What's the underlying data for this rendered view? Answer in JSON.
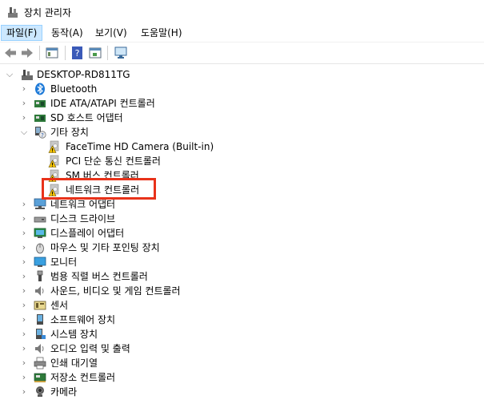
{
  "window": {
    "title": "장치 관리자"
  },
  "menu": {
    "file": "파일(F)",
    "action": "동작(A)",
    "view": "보기(V)",
    "help": "도움말(H)"
  },
  "tree": {
    "root": "DESKTOP-RD811TG",
    "items": [
      {
        "label": "Bluetooth",
        "icon": "bluetooth-icon"
      },
      {
        "label": "IDE ATA/ATAPI 컨트롤러",
        "icon": "ide-controller-icon"
      },
      {
        "label": "SD 호스트 어댑터",
        "icon": "sd-host-icon"
      },
      {
        "label": "기타 장치",
        "icon": "other-devices-icon",
        "expanded": true,
        "children": [
          {
            "label": "FaceTime HD Camera (Built-in)",
            "icon": "warning-device-icon"
          },
          {
            "label": "PCI 단순 통신 컨트롤러",
            "icon": "warning-device-icon"
          },
          {
            "label": "SM 버스 컨트롤러",
            "icon": "warning-device-icon"
          },
          {
            "label": "네트워크 컨트롤러",
            "icon": "warning-device-icon"
          }
        ]
      },
      {
        "label": "네트워크 어댑터",
        "icon": "network-adapter-icon"
      },
      {
        "label": "디스크 드라이브",
        "icon": "disk-drive-icon"
      },
      {
        "label": "디스플레이 어댑터",
        "icon": "display-adapter-icon"
      },
      {
        "label": "마우스 및 기타 포인팅 장치",
        "icon": "mouse-icon"
      },
      {
        "label": "모니터",
        "icon": "monitor-icon"
      },
      {
        "label": "범용 직렬 버스 컨트롤러",
        "icon": "usb-icon"
      },
      {
        "label": "사운드, 비디오 및 게임 컨트롤러",
        "icon": "sound-icon"
      },
      {
        "label": "센서",
        "icon": "sensor-icon"
      },
      {
        "label": "소프트웨어 장치",
        "icon": "software-device-icon"
      },
      {
        "label": "시스템 장치",
        "icon": "system-device-icon"
      },
      {
        "label": "오디오 입력 및 출력",
        "icon": "audio-io-icon"
      },
      {
        "label": "인쇄 대기열",
        "icon": "print-queue-icon"
      },
      {
        "label": "저장소 컨트롤러",
        "icon": "storage-controller-icon"
      },
      {
        "label": "카메라",
        "icon": "camera-icon"
      }
    ]
  },
  "colors": {
    "highlight": "#e8321a",
    "menu_active": "#cce8ff"
  }
}
